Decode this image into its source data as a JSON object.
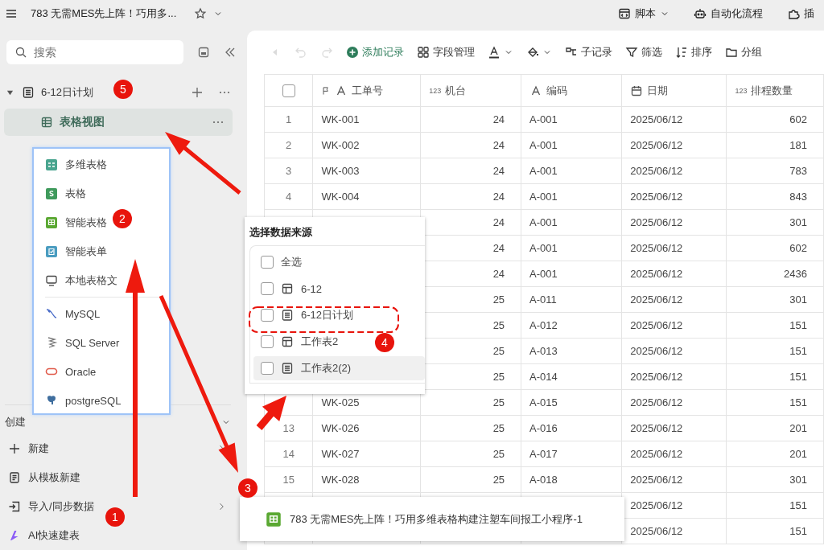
{
  "top_bar": {
    "title": "783 无需MES先上阵！巧用多...",
    "actions": [
      {
        "label": "脚本"
      },
      {
        "label": "自动化流程"
      },
      {
        "label": "插"
      }
    ]
  },
  "sidebar": {
    "search": {
      "placeholder": "搜索"
    },
    "tree": [
      {
        "label": "6-12日计划",
        "expanded": true,
        "selected": false,
        "children": [
          {
            "label": "表格视图",
            "selected": true
          }
        ]
      }
    ],
    "create": {
      "title": "创建",
      "expanded": true,
      "items": [
        {
          "label": "新建"
        },
        {
          "label": "从模板新建"
        },
        {
          "label": "导入/同步数据"
        },
        {
          "label": "AI快速建表"
        }
      ]
    }
  },
  "toolbar": {
    "items": [
      {
        "disabled": true
      },
      {
        "disabled": true
      },
      {
        "disabled": true
      },
      {
        "label": "添加记录",
        "disabled": false
      },
      {
        "label": "字段管理",
        "disabled": false
      },
      {
        "disabled": false
      },
      {
        "disabled": false
      },
      {
        "label": "子记录",
        "disabled": false
      },
      {
        "label": "筛选",
        "disabled": false
      },
      {
        "label": "排序",
        "disabled": false
      },
      {
        "label": "分组",
        "disabled": false
      }
    ]
  },
  "table": {
    "select_all": {
      "checked": false
    },
    "columns": [
      {
        "label": "工单号"
      },
      {
        "label": "机台",
        "type_text": "123"
      },
      {
        "label": "编码"
      },
      {
        "label": "日期"
      },
      {
        "label": "排程数量",
        "type_text": "123"
      }
    ],
    "rows": [
      {
        "num": "1",
        "order": "WK-001",
        "machine": "24",
        "code": "A-001",
        "date": "2025/06/12",
        "qty": "602"
      },
      {
        "num": "2",
        "order": "WK-002",
        "machine": "24",
        "code": "A-001",
        "date": "2025/06/12",
        "qty": "181"
      },
      {
        "num": "3",
        "order": "WK-003",
        "machine": "24",
        "code": "A-001",
        "date": "2025/06/12",
        "qty": "783"
      },
      {
        "num": "4",
        "order": "WK-004",
        "machine": "24",
        "code": "A-001",
        "date": "2025/06/12",
        "qty": "843"
      },
      {
        "machine": "24",
        "code": "A-001",
        "date": "2025/06/12",
        "qty": "301"
      },
      {
        "machine": "24",
        "code": "A-001",
        "date": "2025/06/12",
        "qty": "602"
      },
      {
        "machine": "24",
        "code": "A-001",
        "date": "2025/06/12",
        "qty": "2436"
      },
      {
        "machine": "25",
        "code": "A-011",
        "date": "2025/06/12",
        "qty": "301"
      },
      {
        "machine": "25",
        "code": "A-012",
        "date": "2025/06/12",
        "qty": "151"
      },
      {
        "machine": "25",
        "code": "A-013",
        "date": "2025/06/12",
        "qty": "151"
      },
      {
        "machine": "25",
        "code": "A-014",
        "date": "2025/06/12",
        "qty": "151"
      },
      {
        "order": "WK-025",
        "machine": "25",
        "code": "A-015",
        "date": "2025/06/12",
        "qty": "151"
      },
      {
        "num": "13",
        "order": "WK-026",
        "machine": "25",
        "code": "A-016",
        "date": "2025/06/12",
        "qty": "201"
      },
      {
        "num": "14",
        "order": "WK-027",
        "machine": "25",
        "code": "A-017",
        "date": "2025/06/12",
        "qty": "201"
      },
      {
        "num": "15",
        "order": "WK-028",
        "machine": "25",
        "code": "A-018",
        "date": "2025/06/12",
        "qty": "301"
      },
      {
        "date": "2025/06/12",
        "qty": "151"
      },
      {
        "date": "2025/06/12",
        "qty": "151"
      }
    ]
  },
  "import_menu": {
    "groups": [
      [
        {
          "label": "多维表格"
        },
        {
          "label": "表格"
        },
        {
          "label": "智能表格"
        },
        {
          "label": "智能表单"
        },
        {
          "label": "本地表格文"
        }
      ],
      [
        {
          "label": "MySQL"
        },
        {
          "label": "SQL Server"
        },
        {
          "label": "Oracle"
        },
        {
          "label": "postgreSQL"
        }
      ]
    ]
  },
  "source_picker": {
    "title": "选择数据来源",
    "items": [
      {
        "label": "全选",
        "checked": false,
        "hovered": false
      },
      {
        "label": "6-12",
        "checked": false,
        "hovered": false
      },
      {
        "label": "6-12日计划",
        "checked": false,
        "hovered": false
      },
      {
        "label": "工作表2",
        "checked": false,
        "hovered": false
      },
      {
        "label": "工作表2(2)",
        "checked": false,
        "hovered": true
      }
    ]
  },
  "toast": {
    "text": "783 无需MES先上阵！巧用多维表格构建注塑车间报工小程序-1"
  },
  "annotations": [
    {
      "number": "5"
    },
    {
      "number": "2"
    },
    {
      "number": "1"
    },
    {
      "number": "3"
    },
    {
      "number": "4"
    }
  ]
}
